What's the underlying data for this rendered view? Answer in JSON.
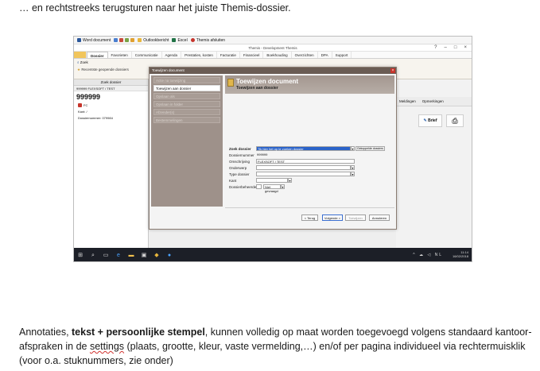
{
  "document": {
    "top_line": "… en rechtstreeks terugsturen naar het juiste Themis-dossier.",
    "para_1": "Annotaties, ",
    "para_bold": "tekst + persoonlijke stempel",
    "para_2": ", kunnen volledig op maat worden toegevoegd volgens standaard kantoor-afspraken in de ",
    "para_squiggle": "settings",
    "para_3": " (plaats, grootte, kleur, vaste vermelding,…) en/of per pagina individueel via rechtermuisklik (voor o.a. stuknummers, zie onder)"
  },
  "word_bar": {
    "word_document": "Word document",
    "outlookbericht": "Outlookbericht",
    "excel": "Excel",
    "themis_afsluiten": "Themis afsluiten"
  },
  "app": {
    "title": "Themis - Development Themis",
    "window_controls": [
      "?",
      "–",
      "□",
      "×"
    ],
    "tabs": [
      "Dossier",
      "Favorieten",
      "Communicatie",
      "Agenda",
      "Prestaties, kosten",
      "Facturatie",
      "Financieel",
      "Boekhouding",
      "Overzichten",
      "DPA",
      "Support"
    ],
    "active_tab": "Dossier",
    "ribbon_zoek": "Zoek",
    "ribbon_recent": "Recentste geopende dossiers",
    "ribbon_documenten": "Documenten"
  },
  "left_panel": {
    "header": "Zoek dossier",
    "file_label": "999999 FLEXSOFT / TEST",
    "number": "999999",
    "rows": [
      "FC",
      "Kant: /",
      "Dossiernummer: 079984"
    ]
  },
  "right_panel": {
    "tabs": [
      "Meldingen",
      "Opmerkingen"
    ],
    "brief_button": "Brief"
  },
  "dialog": {
    "title": "Toewijzen document",
    "heading": "Toewijzen document",
    "subheading": "Toewijzen aan dossier",
    "steps": [
      "Actie na toewijzing",
      "Toewijzen aan dossier",
      "Opslaan als",
      "Opslaan in folder",
      "Afzender(s)",
      "Bestemmelingen"
    ],
    "active_step": "Toewijzen aan dossier",
    "form": {
      "zoek_dossier_label": "Zoek dossier",
      "zoek_dossier_value": "Tik hier het op te zoeken dossier",
      "gekoppelde_button": "Gekoppelde dossiers",
      "dossiernummer_label": "Dossiernummer",
      "dossiernummer_value": "999999",
      "omschrijving_label": "Omschrijving",
      "omschrijving_value": "FLEXSOFT / TEST",
      "onderwerp_label": "Onderwerp",
      "type_dossier_label": "Type dossier",
      "kant_label": "Kant",
      "dossierbeheerder_label": "Dossierbeheerder",
      "dossierbeheerder_value": "Niet gevraagd"
    },
    "buttons": {
      "back": "< Terug",
      "next": "Volgende >",
      "finish": "Toewijzen",
      "cancel": "Annuleren"
    }
  },
  "taskbar": {
    "time": "11:14",
    "date": "16/02/2018",
    "tray": "^ ☁ ◁ NL"
  }
}
